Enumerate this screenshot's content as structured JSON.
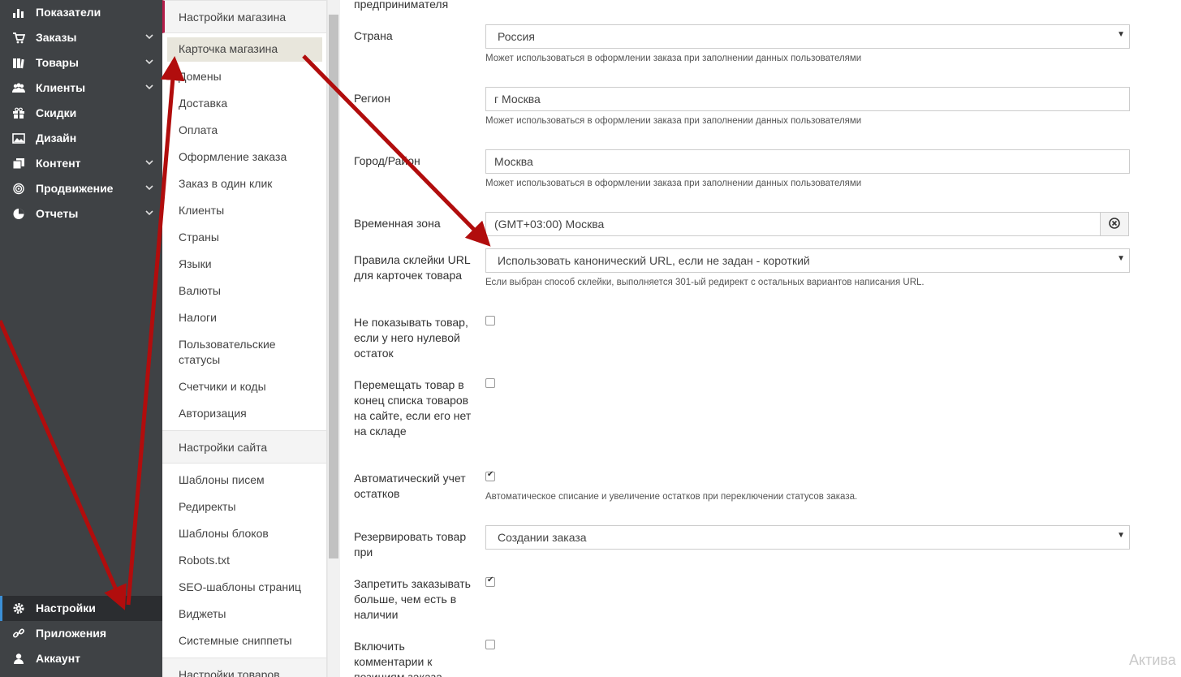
{
  "sidebar": {
    "items": [
      {
        "label": "Показатели",
        "icon": "bar-chart-icon",
        "chevron": false
      },
      {
        "label": "Заказы",
        "icon": "cart-icon",
        "chevron": true
      },
      {
        "label": "Товары",
        "icon": "books-icon",
        "chevron": true
      },
      {
        "label": "Клиенты",
        "icon": "users-icon",
        "chevron": true
      },
      {
        "label": "Скидки",
        "icon": "gift-icon",
        "chevron": false
      },
      {
        "label": "Дизайн",
        "icon": "image-icon",
        "chevron": false
      },
      {
        "label": "Контент",
        "icon": "pages-icon",
        "chevron": true
      },
      {
        "label": "Продвижение",
        "icon": "target-icon",
        "chevron": true
      },
      {
        "label": "Отчеты",
        "icon": "pie-chart-icon",
        "chevron": true
      }
    ],
    "bottom": [
      {
        "label": "Настройки",
        "icon": "gear-icon",
        "active": true
      },
      {
        "label": "Приложения",
        "icon": "link-icon",
        "active": false
      },
      {
        "label": "Аккаунт",
        "icon": "user-icon",
        "active": false
      }
    ]
  },
  "submenu": {
    "store_header": "Настройки магазина",
    "store_items": [
      "Карточка магазина",
      "Домены",
      "Доставка",
      "Оплата",
      "Оформление заказа",
      "Заказ в один клик",
      "Клиенты",
      "Страны",
      "Языки",
      "Валюты",
      "Налоги",
      "Пользовательские статусы",
      "Счетчики и коды",
      "Авторизация"
    ],
    "site_header": "Настройки сайта",
    "site_items": [
      "Шаблоны писем",
      "Редиректы",
      "Шаблоны блоков",
      "Robots.txt",
      "SEO-шаблоны страниц",
      "Виджеты",
      "Системные сниппеты"
    ],
    "goods_header": "Настройки товаров"
  },
  "form": {
    "top_fragment": "предпринимателя",
    "country": {
      "label": "Страна",
      "value": "Россия",
      "hint": "Может использоваться в оформлении заказа при заполнении данных пользователями"
    },
    "region": {
      "label": "Регион",
      "value": "г Москва",
      "hint": "Может использоваться в оформлении заказа при заполнении данных пользователями"
    },
    "city": {
      "label": "Город/Район",
      "value": "Москва",
      "hint": "Может использоваться в оформлении заказа при заполнении данных пользователями"
    },
    "timezone": {
      "label": "Временная зона",
      "value": "(GMT+03:00) Москва"
    },
    "url_rules": {
      "label": "Правила склейки URL для карточек товара",
      "value": "Использовать канонический URL, если не задан - короткий",
      "hint": "Если выбран способ склейки, выполняется 301-ый редирект с остальных вариантов написания URL."
    },
    "hide_zero": {
      "label": "Не показывать товар, если у него нулевой остаток",
      "checked": false
    },
    "move_end": {
      "label": "Перемещать товар в конец списка товаров на сайте, если его нет на складе",
      "checked": false
    },
    "auto_stock": {
      "label": "Автоматический учет остатков",
      "checked": true,
      "hint": "Автоматическое списание и увеличение остатков при переключении статусов заказа."
    },
    "reserve": {
      "label": "Резервировать товар при",
      "value": "Создании заказа"
    },
    "forbid_more": {
      "label": "Запретить заказывать больше, чем есть в наличии",
      "checked": true
    },
    "comments": {
      "label": "Включить комментарии к позициям заказа",
      "checked": false
    }
  },
  "watermark": "Актива",
  "colors": {
    "sidebar_bg": "#3f4245",
    "active_bg": "#2b2d30",
    "accent": "#b51d4a",
    "arrow": "#b10d0d"
  }
}
